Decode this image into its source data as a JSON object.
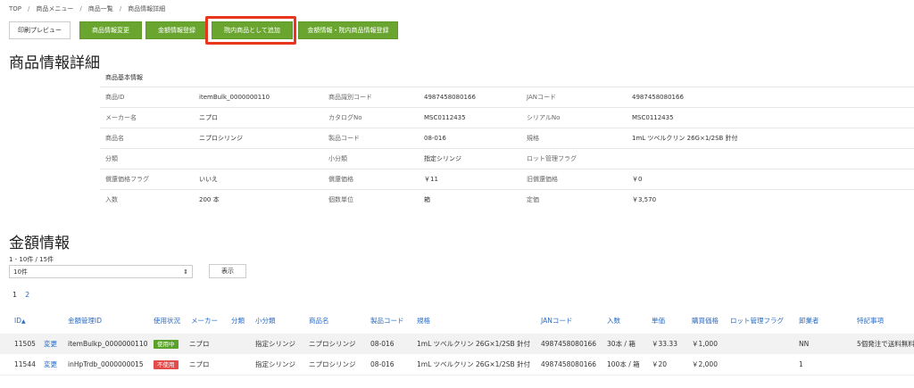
{
  "breadcrumb": [
    "TOP",
    "商品メニュー",
    "商品一覧",
    "商品情報詳細"
  ],
  "toolbar": {
    "print_preview": "印刷プレビュー",
    "edit_product": "商品情報変更",
    "register_price": "金額情報登録",
    "add_inhouse": "院内商品として追加",
    "register_price_inhouse": "金額情報・院内商品情報登録"
  },
  "page_title": "商品情報詳細",
  "basic_info": {
    "heading": "商品基本情報",
    "rows": [
      [
        "商品ID",
        "itemBulk_0000000110",
        "商品識別コード",
        "4987458080166",
        "JANコード",
        "4987458080166"
      ],
      [
        "メーカー名",
        "ニプロ",
        "カタログNo",
        "MSC0112435",
        "シリアルNo",
        "MSC0112435"
      ],
      [
        "商品名",
        "ニプロシリンジ",
        "製品コード",
        "08-016",
        "規格",
        "1mL ツベルクリン 26G×1/2SB 針付"
      ],
      [
        "分類",
        "",
        "小分類",
        "指定シリンジ",
        "ロット管理フラグ",
        ""
      ],
      [
        "償還価格フラグ",
        "いいえ",
        "償還価格",
        "￥11",
        "旧償還価格",
        "￥0"
      ],
      [
        "入数",
        "200 本",
        "個数単位",
        "箱",
        "定価",
        "￥3,570"
      ]
    ]
  },
  "price_section": {
    "title": "金額情報",
    "count": "1 - 10件 / 15件",
    "per_page": "10件",
    "show_button": "表示",
    "pages": [
      "1",
      "2"
    ],
    "sort_icon": "▲",
    "columns": [
      "ID",
      "金額管理ID",
      "使用状況",
      "メーカー",
      "分類",
      "小分類",
      "商品名",
      "製品コード",
      "規格",
      "JANコード",
      "入数",
      "単価",
      "購買価格",
      "ロット管理フラグ",
      "卸業者",
      "特記事項"
    ],
    "rows": [
      {
        "id": "11505",
        "edit": "変更",
        "price_id": "itemBulkp_0000000110",
        "status": "使用中",
        "status_color": "#5aa22a",
        "maker": "ニプロ",
        "category": "",
        "subcategory": "指定シリンジ",
        "name": "ニプロシリンジ",
        "code": "08-016",
        "spec": "1mL ツベルクリン 26G×1/2SB 針付",
        "jan": "4987458080166",
        "qty": "30本 / 箱",
        "unit_price": "￥33.33",
        "purchase_price": "￥1,000",
        "lot_flag": "",
        "wholesaler": "NN",
        "note": "5個発注で送料無料"
      },
      {
        "id": "11544",
        "edit": "変更",
        "price_id": "inHpTrdb_0000000015",
        "status": "不使用",
        "status_color": "#e44b4b",
        "maker": "ニプロ",
        "category": "",
        "subcategory": "指定シリンジ",
        "name": "ニプロシリンジ",
        "code": "08-016",
        "spec": "1mL ツベルクリン 26G×1/2SB 針付",
        "jan": "4987458080166",
        "qty": "100本 / 箱",
        "unit_price": "￥20",
        "purchase_price": "￥2,000",
        "lot_flag": "",
        "wholesaler": "1",
        "note": ""
      }
    ]
  }
}
